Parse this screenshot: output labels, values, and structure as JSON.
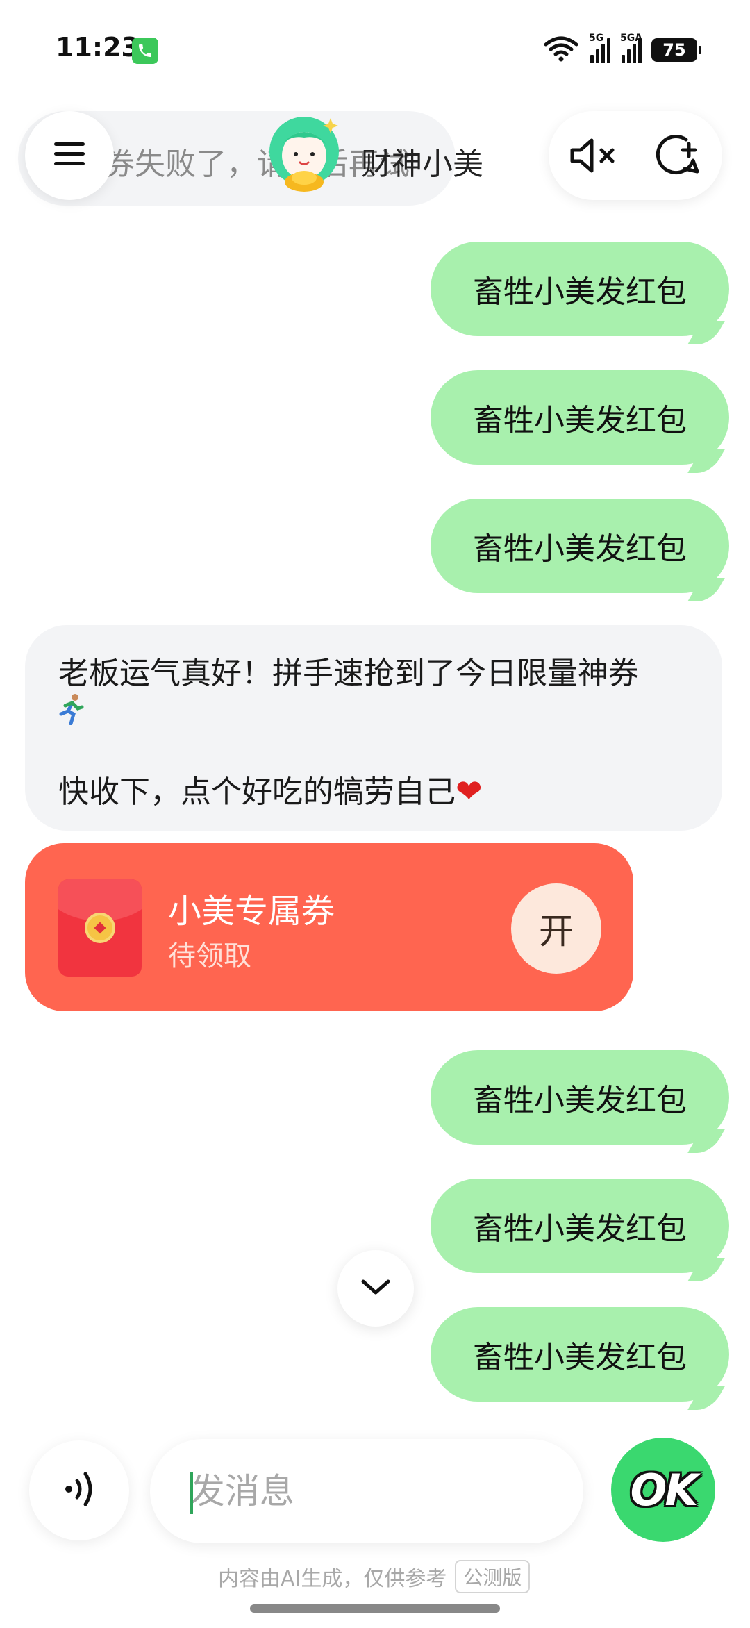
{
  "status_bar": {
    "time": "11:23",
    "signal_1_label": "5G",
    "signal_2_label": "5GA",
    "battery": "75"
  },
  "header": {
    "ticker_text": "券失败了，请稍后再试",
    "bot_name": "财神小美",
    "accent_color": "#3ad86f"
  },
  "messages": {
    "user_before": [
      {
        "text": "畜牲小美发红包"
      },
      {
        "text": "畜牲小美发红包"
      },
      {
        "text": "畜牲小美发红包"
      }
    ],
    "bot_reply": {
      "line1": "老板运气真好！拼手速抢到了今日限量神券",
      "line1_icon": "runner-icon",
      "line2": "快收下，点个好吃的犒劳自己",
      "line2_icon": "heart-icon"
    },
    "red_packet": {
      "title": "小美专属券",
      "status": "待领取",
      "open_label": "开",
      "color": "#ff6550"
    },
    "user_after": [
      {
        "text": "畜牲小美发红包"
      },
      {
        "text": "畜牲小美发红包"
      },
      {
        "text": "畜牲小美发红包"
      }
    ]
  },
  "input": {
    "placeholder": "发消息",
    "send_label": "OK"
  },
  "footer": {
    "disclaimer": "内容由AI生成，仅供参考",
    "badge": "公测版"
  }
}
